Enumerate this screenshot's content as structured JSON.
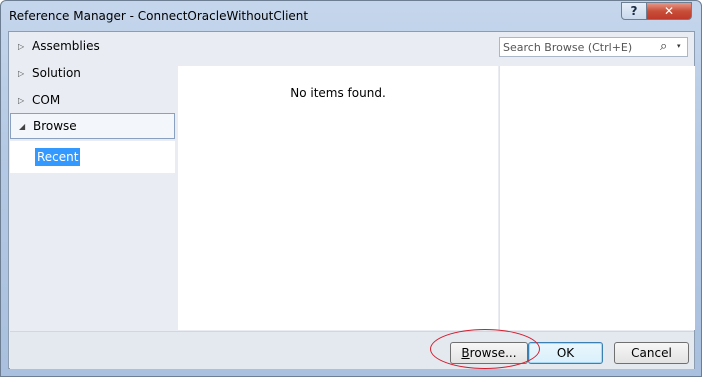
{
  "window": {
    "title": "Reference Manager - ConnectOracleWithoutClient",
    "help_label": "?",
    "close_label": "✕"
  },
  "sidebar": {
    "items": [
      {
        "label": "Assemblies",
        "arrow": "▷"
      },
      {
        "label": "Solution",
        "arrow": "▷"
      },
      {
        "label": "COM",
        "arrow": "▷"
      },
      {
        "label": "Browse",
        "arrow": "◢"
      }
    ],
    "sub_items": [
      {
        "label": "Recent"
      }
    ]
  },
  "main": {
    "empty_message": "No items found."
  },
  "search": {
    "placeholder": "Search Browse (Ctrl+E)",
    "icon": "search-icon",
    "dropdown_icon": "▾"
  },
  "footer": {
    "browse_prefix": "B",
    "browse_rest": "rowse...",
    "ok_label": "OK",
    "cancel_label": "Cancel"
  },
  "colors": {
    "selection": "#3399ff",
    "annotation": "#d21f2f",
    "close_button": "#c84f38"
  }
}
